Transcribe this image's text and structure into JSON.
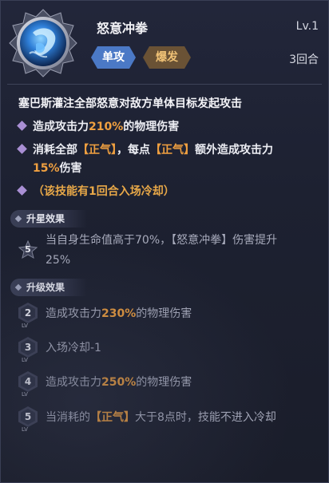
{
  "skill": {
    "name": "怒意冲拳",
    "level": "Lv.1",
    "tags": [
      "单攻",
      "爆发"
    ],
    "rounds": "3回合"
  },
  "description": "塞巴斯灌注全部怒意对敌方单体目标发起攻击",
  "effects": {
    "e1": {
      "pre": "造成攻击力",
      "value": "210%",
      "post": "的物理伤害"
    },
    "e2": {
      "pre": "消耗全部",
      "res1": "【正气】",
      "mid": "，每点",
      "res2": "【正气】",
      "post": "额外造成攻击力",
      "value": "15%",
      "post2": "伤害"
    },
    "note": "（该技能有1回合入场冷却）"
  },
  "star_section": {
    "title": "升星效果",
    "badge": "5",
    "text_line1": "当自身生命值高于70%，【怒意冲拳】伤害提升",
    "text_line2": "25%"
  },
  "upgrade_section": {
    "title": "升级效果",
    "lv_label": "LV",
    "items": [
      {
        "level": "2",
        "pre": "造成攻击力",
        "value": "230%",
        "post": "的物理伤害"
      },
      {
        "level": "3",
        "pre": "入场冷却-1",
        "value": "",
        "post": ""
      },
      {
        "level": "4",
        "pre": "造成攻击力",
        "value": "250%",
        "post": "的物理伤害"
      },
      {
        "level": "5",
        "pre": "当消耗的",
        "value": "【正气】",
        "post": "大于8点时，技能不进入冷却"
      }
    ]
  },
  "colors": {
    "accent_orange": "#f0a040",
    "tag_single": "#4b79c6",
    "tag_burst": "#6a5235",
    "bullet_purple": "#a98fd4"
  },
  "icons": [
    "skill-portrait-icon",
    "diamond-bullet-icon",
    "star-badge-icon",
    "level-hex-icon"
  ]
}
